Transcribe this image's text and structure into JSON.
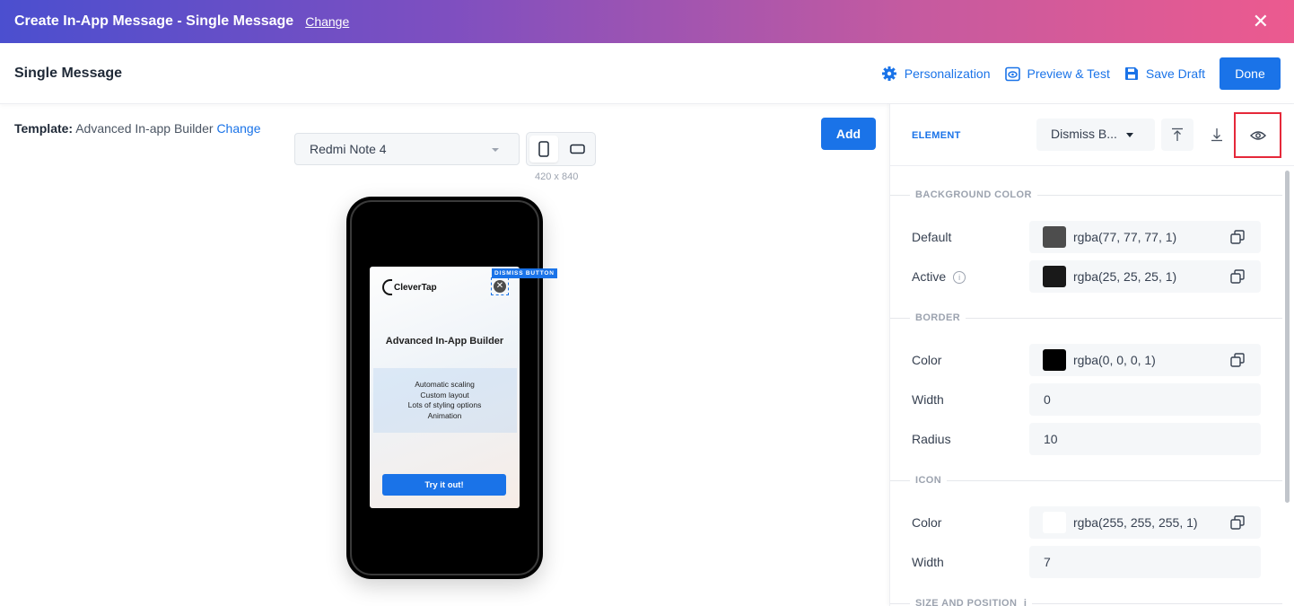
{
  "topbar": {
    "title": "Create In-App Message - Single Message",
    "change_label": "Change",
    "close_glyph": "✕"
  },
  "header": {
    "name": "Single Message",
    "actions": {
      "personalization": "Personalization",
      "preview": "Preview & Test",
      "save_draft": "Save Draft",
      "done": "Done"
    }
  },
  "template": {
    "label": "Template:",
    "value": "Advanced In-app Builder",
    "change": "Change"
  },
  "device": {
    "selected": "Redmi Note 4",
    "dimensions": "420 x 840"
  },
  "add_label": "Add",
  "preview": {
    "logo_text": "CleverTap",
    "headline": "Advanced In-App Builder",
    "features": [
      "Automatic scaling",
      "Custom layout",
      "Lots of styling options",
      "Animation"
    ],
    "cta": "Try it out!",
    "dismiss_tag": "DISMISS BUTTON",
    "dismiss_glyph": "✕"
  },
  "panel": {
    "element_label": "ELEMENT",
    "element_selected": "Dismiss B...",
    "sections": {
      "background": "BACKGROUND COLOR",
      "border": "BORDER",
      "icon": "ICON",
      "size": "SIZE AND POSITION"
    },
    "background": {
      "default_label": "Default",
      "default_value": "rgba(77, 77, 77, 1)",
      "default_color": "#4d4d4d",
      "active_label": "Active",
      "active_value": "rgba(25, 25, 25, 1)",
      "active_color": "#191919"
    },
    "border": {
      "color_label": "Color",
      "color_value": "rgba(0, 0, 0, 1)",
      "color_swatch": "#000000",
      "width_label": "Width",
      "width_value": "0",
      "radius_label": "Radius",
      "radius_value": "10"
    },
    "icon": {
      "color_label": "Color",
      "color_value": "rgba(255, 255, 255, 1)",
      "color_swatch": "#ffffff",
      "width_label": "Width",
      "width_value": "7"
    }
  },
  "colors": {
    "accent": "#1a73e8",
    "highlight": "#e5283a"
  }
}
